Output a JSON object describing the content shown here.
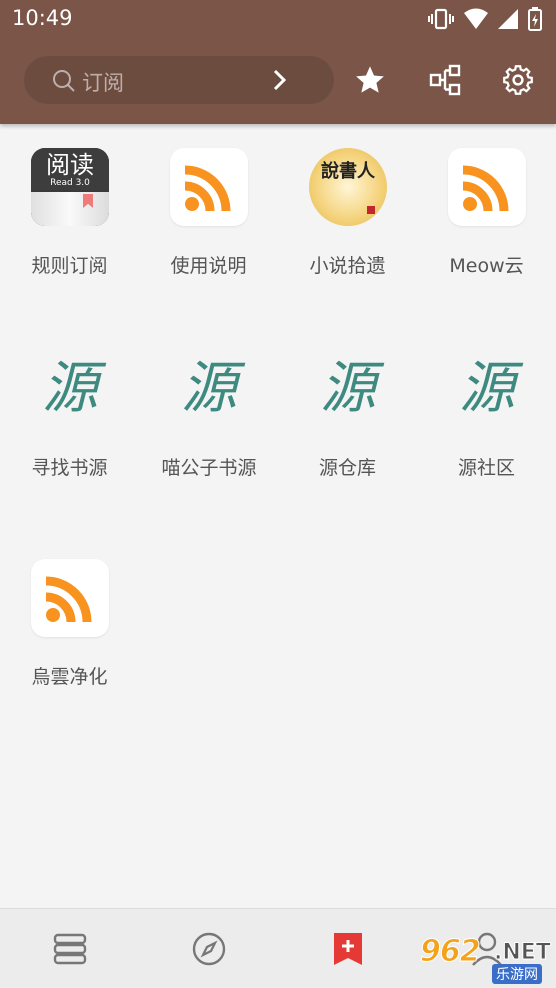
{
  "status_bar": {
    "time": "10:49"
  },
  "toolbar": {
    "search_placeholder": "订阅"
  },
  "subscriptions": [
    {
      "label": "规则订阅",
      "icon": "read-app-icon",
      "logo_text": "阅读",
      "logo_sub": "Read 3.0"
    },
    {
      "label": "使用说明",
      "icon": "rss-icon"
    },
    {
      "label": "小说拾遗",
      "icon": "novel-calligraphy-icon",
      "logo_text": "說書人"
    },
    {
      "label": "Meow云",
      "icon": "rss-icon"
    },
    {
      "label": "寻找书源",
      "icon": "source-calligraphy-icon",
      "logo_text": "源"
    },
    {
      "label": "喵公子书源",
      "icon": "source-calligraphy-icon",
      "logo_text": "源"
    },
    {
      "label": "源仓库",
      "icon": "source-calligraphy-icon",
      "logo_text": "源"
    },
    {
      "label": "源社区",
      "icon": "source-calligraphy-icon",
      "logo_text": "源"
    },
    {
      "label": "烏雲净化",
      "icon": "rss-icon"
    }
  ],
  "bottom_nav": [
    {
      "name": "bookshelf",
      "icon": "bookshelf-icon"
    },
    {
      "name": "discover",
      "icon": "compass-icon"
    },
    {
      "name": "subscription",
      "icon": "bookmark-icon",
      "active": true
    },
    {
      "name": "profile",
      "icon": "person-icon"
    }
  ],
  "watermark": {
    "number": "962",
    "net": ".NET",
    "sub": "乐游网"
  },
  "colors": {
    "appbar": "#7a5548",
    "accent": "#e53935",
    "rss_orange": "#f7931e",
    "background": "#f4f4f4"
  }
}
